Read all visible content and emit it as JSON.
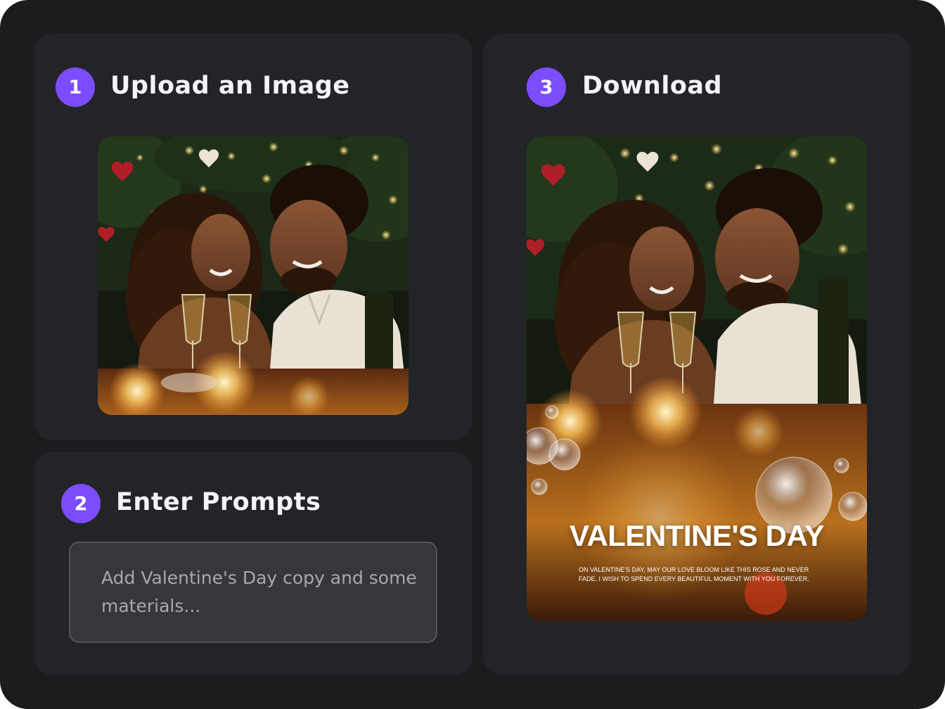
{
  "steps": {
    "upload": {
      "number": "1",
      "title": "Upload an Image",
      "image_alt": "couple-photo"
    },
    "prompt": {
      "number": "2",
      "title": "Enter Prompts",
      "placeholder": "Add Valentine's Day copy and some materials..."
    },
    "download": {
      "number": "3",
      "title": "Download",
      "poster_title": "VALENTINE'S DAY",
      "poster_subtitle": "ON VALENTINE'S DAY, MAY OUR LOVE BLOOM LIKE THIS ROSE AND NEVER FADE. I WISH TO SPEND EVERY BEAUTIFUL MOMENT WITH YOU FOREVER."
    }
  },
  "colors": {
    "accent": "#7c4dff",
    "background": "#1b1c1e",
    "card": "#232427",
    "input": "#36373b"
  }
}
